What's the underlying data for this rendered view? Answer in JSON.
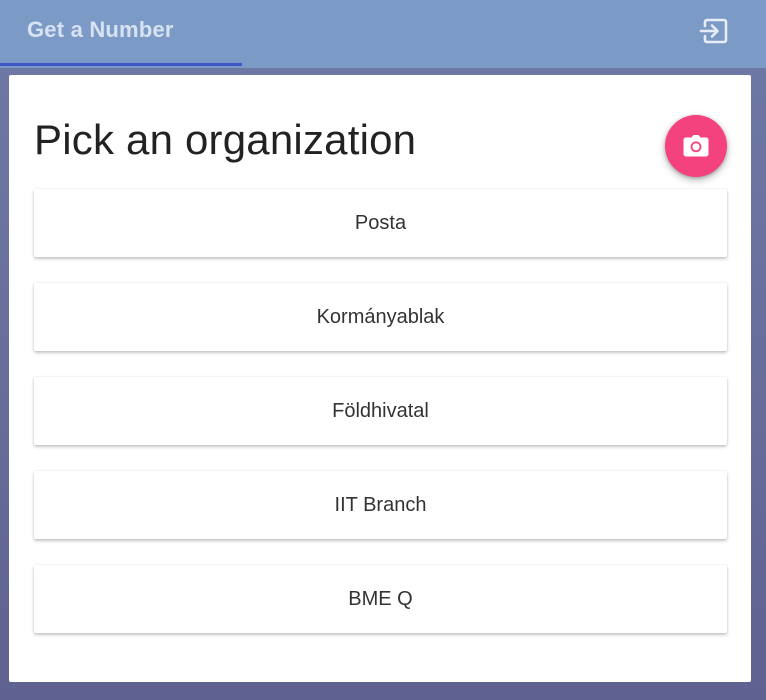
{
  "app_bar": {
    "tab_label": "Get a Number",
    "exit_icon": "exit-to-app-icon",
    "background_color": "#7b9ac6",
    "indicator_color": "#3f56c6"
  },
  "main": {
    "title": "Pick an organization",
    "camera_button_icon": "camera-icon",
    "camera_button_color": "#f4427f",
    "organizations": [
      {
        "label": "Posta"
      },
      {
        "label": "Kormányablak"
      },
      {
        "label": "Földhivatal"
      },
      {
        "label": "IIT Branch"
      },
      {
        "label": "BME Q"
      }
    ]
  }
}
